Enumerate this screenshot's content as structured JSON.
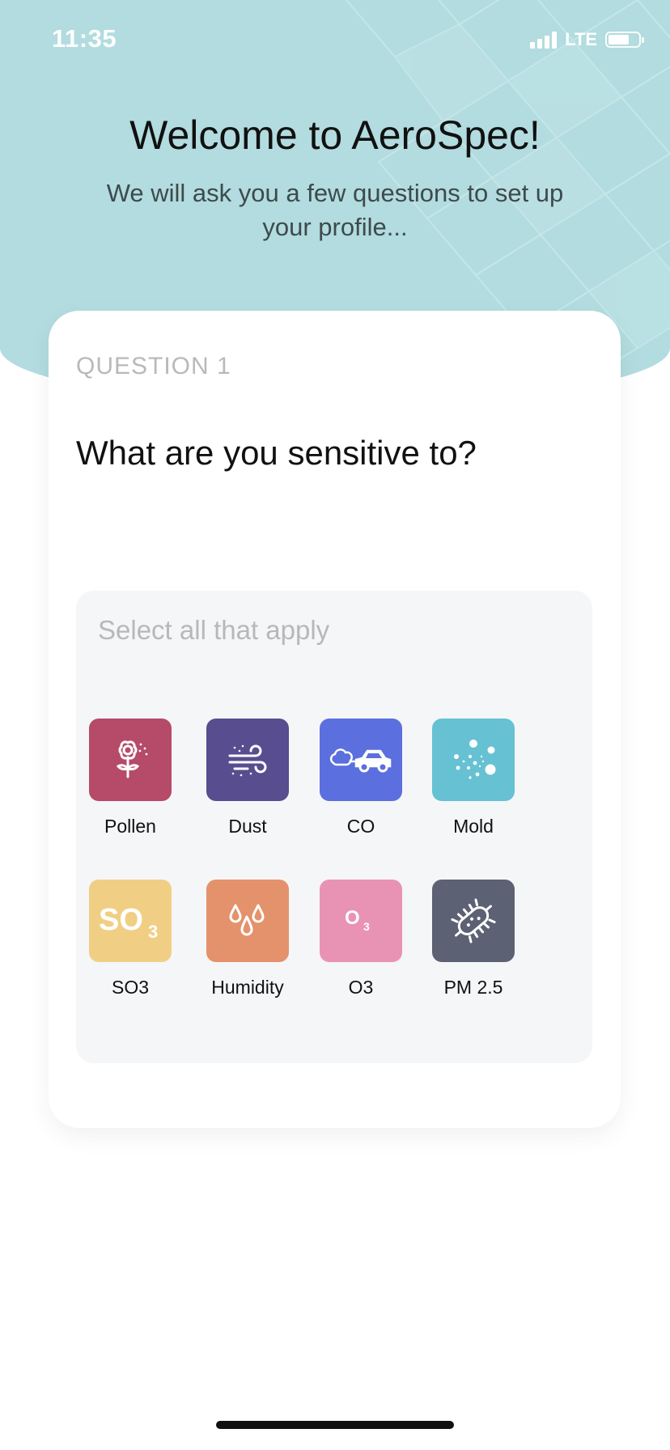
{
  "status_bar": {
    "time": "11:35",
    "network": "LTE"
  },
  "header": {
    "title": "Welcome to AeroSpec!",
    "subtitle": "We will ask you a few questions to set up your profile..."
  },
  "question": {
    "label": "QUESTION 1",
    "text": "What are you sensitive to?",
    "hint": "Select all that apply",
    "options": [
      {
        "label": "Pollen",
        "icon": "flower-icon",
        "color": "#b54a69"
      },
      {
        "label": "Dust",
        "icon": "wind-dust-icon",
        "color": "#574d8f"
      },
      {
        "label": "CO",
        "icon": "car-exhaust-icon",
        "color": "#5c6fde"
      },
      {
        "label": "Mold",
        "icon": "spores-icon",
        "color": "#66c1d3"
      },
      {
        "label": "SO3",
        "icon": "so3-icon",
        "color": "#f0cf85"
      },
      {
        "label": "Humidity",
        "icon": "droplets-icon",
        "color": "#e4926b"
      },
      {
        "label": "O3",
        "icon": "o3-icon",
        "color": "#e993b4"
      },
      {
        "label": "PM 2.5",
        "icon": "bacteria-icon",
        "color": "#5c6173"
      }
    ]
  }
}
